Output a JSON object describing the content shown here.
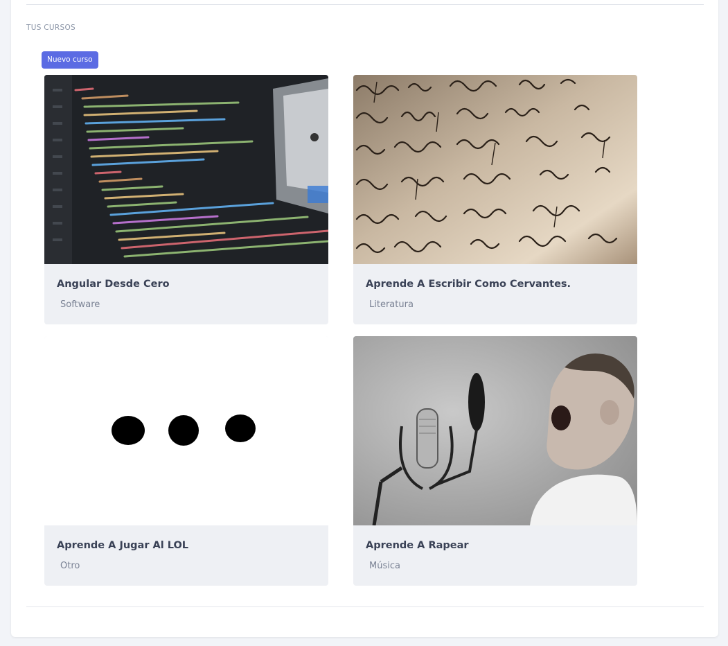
{
  "section": {
    "title": "TUS CURSOS"
  },
  "new_course_button": "Nuevo curso",
  "courses": [
    {
      "title": "Angular Desde Cero",
      "category": "Software",
      "image": "code-editor-photo"
    },
    {
      "title": "Aprende A Escribir Como Cervantes.",
      "category": "Literatura",
      "image": "handwritten-letter-photo"
    },
    {
      "title": "Aprende A Jugar Al LOL",
      "category": "Otro",
      "image": "three-dots-image"
    },
    {
      "title": "Aprende A Rapear",
      "category": "Música",
      "image": "boy-microphone-photo"
    }
  ],
  "colors": {
    "accent": "#5b6be3",
    "card_bg": "#eef0f4",
    "title": "#3a4256",
    "category": "#7a8294"
  }
}
